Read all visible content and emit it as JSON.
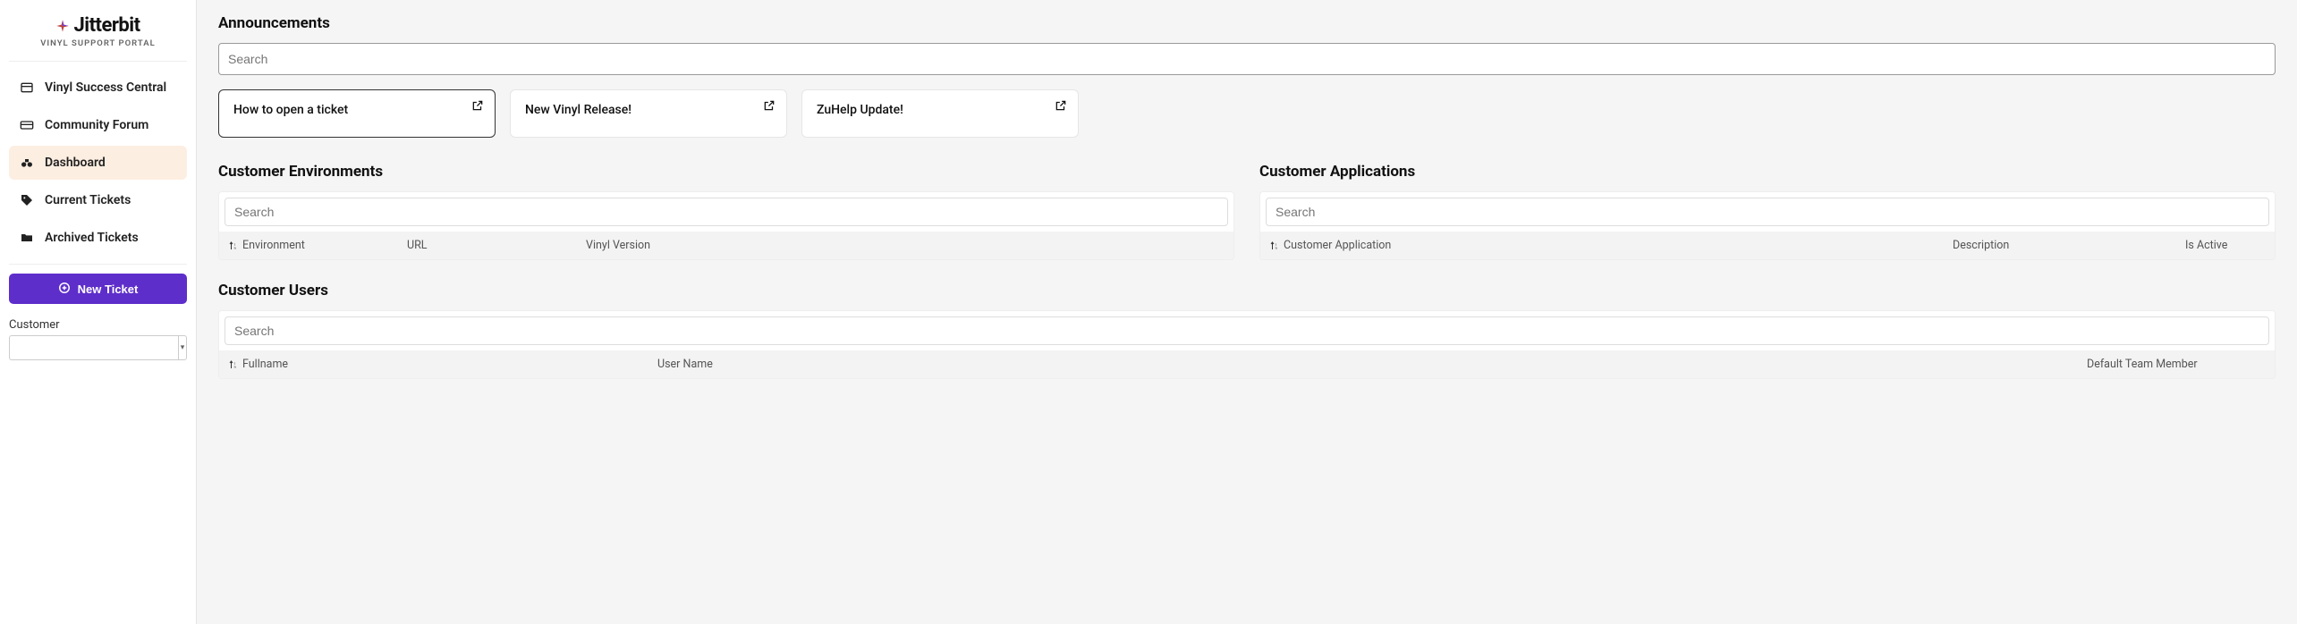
{
  "brand": {
    "name": "Jitterbit",
    "sub": "VINYL SUPPORT PORTAL"
  },
  "sidebar": {
    "items": [
      {
        "label": "Vinyl Success Central",
        "icon": "grid-icon",
        "active": false
      },
      {
        "label": "Community Forum",
        "icon": "card-icon",
        "active": false
      },
      {
        "label": "Dashboard",
        "icon": "binoculars-icon",
        "active": true
      },
      {
        "label": "Current Tickets",
        "icon": "tag-icon",
        "active": false
      },
      {
        "label": "Archived Tickets",
        "icon": "folder-icon",
        "active": false
      }
    ],
    "new_ticket_label": "New Ticket",
    "customer_label": "Customer",
    "customer_value": ""
  },
  "announcements": {
    "title": "Announcements",
    "search_placeholder": "Search",
    "cards": [
      {
        "title": "How to open a ticket",
        "selected": true
      },
      {
        "title": "New Vinyl Release!",
        "selected": false
      },
      {
        "title": "ZuHelp Update!",
        "selected": false
      }
    ]
  },
  "customer_environments": {
    "title": "Customer Environments",
    "search_placeholder": "Search",
    "columns": [
      "Environment",
      "URL",
      "Vinyl Version"
    ],
    "rows": []
  },
  "customer_applications": {
    "title": "Customer Applications",
    "search_placeholder": "Search",
    "columns": [
      "Customer Application",
      "Description",
      "Is Active"
    ],
    "rows": []
  },
  "customer_users": {
    "title": "Customer Users",
    "search_placeholder": "Search",
    "columns": [
      "Fullname",
      "User Name",
      "Default Team Member"
    ],
    "rows": []
  }
}
